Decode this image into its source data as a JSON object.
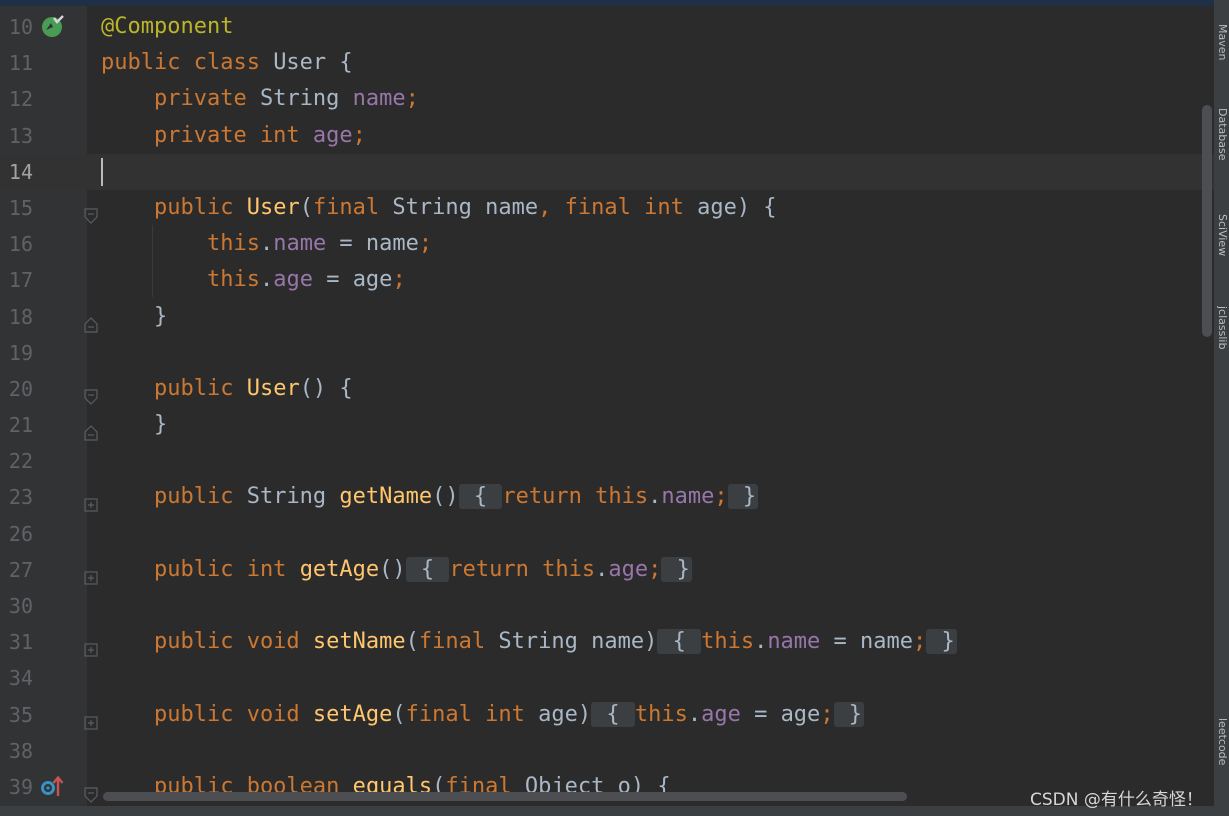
{
  "editor": {
    "lines": [
      {
        "no": "10",
        "tokens": [
          {
            "t": "@Component",
            "c": "a"
          }
        ]
      },
      {
        "no": "11",
        "tokens": [
          {
            "t": "public class ",
            "c": "k"
          },
          {
            "t": "User {",
            "c": "p"
          }
        ]
      },
      {
        "no": "12",
        "tokens": [
          {
            "t": "    private ",
            "c": "k"
          },
          {
            "t": "String ",
            "c": "p"
          },
          {
            "t": "name",
            "c": "f"
          },
          {
            "t": ";",
            "c": "k"
          }
        ]
      },
      {
        "no": "13",
        "tokens": [
          {
            "t": "    private int ",
            "c": "k"
          },
          {
            "t": "age",
            "c": "f"
          },
          {
            "t": ";",
            "c": "k"
          }
        ]
      },
      {
        "no": "14",
        "tokens": []
      },
      {
        "no": "15",
        "tokens": [
          {
            "t": "    public ",
            "c": "k"
          },
          {
            "t": "User",
            "c": "m"
          },
          {
            "t": "(",
            "c": "p"
          },
          {
            "t": "final ",
            "c": "k"
          },
          {
            "t": "String name",
            "c": "p"
          },
          {
            "t": ", ",
            "c": "k"
          },
          {
            "t": "final int ",
            "c": "k"
          },
          {
            "t": "age) {",
            "c": "p"
          }
        ]
      },
      {
        "no": "16",
        "tokens": [
          {
            "t": "        this",
            "c": "k"
          },
          {
            "t": ".",
            "c": "p"
          },
          {
            "t": "name",
            "c": "f"
          },
          {
            "t": " = name",
            "c": "p"
          },
          {
            "t": ";",
            "c": "k"
          }
        ]
      },
      {
        "no": "17",
        "tokens": [
          {
            "t": "        this",
            "c": "k"
          },
          {
            "t": ".",
            "c": "p"
          },
          {
            "t": "age",
            "c": "f"
          },
          {
            "t": " = age",
            "c": "p"
          },
          {
            "t": ";",
            "c": "k"
          }
        ]
      },
      {
        "no": "18",
        "tokens": [
          {
            "t": "    }",
            "c": "p"
          }
        ]
      },
      {
        "no": "19",
        "tokens": []
      },
      {
        "no": "20",
        "tokens": [
          {
            "t": "    public ",
            "c": "k"
          },
          {
            "t": "User",
            "c": "m"
          },
          {
            "t": "() {",
            "c": "p"
          }
        ]
      },
      {
        "no": "21",
        "tokens": [
          {
            "t": "    }",
            "c": "p"
          }
        ]
      },
      {
        "no": "22",
        "tokens": []
      },
      {
        "no": "23",
        "tokens": [
          {
            "t": "    public ",
            "c": "k"
          },
          {
            "t": "String ",
            "c": "p"
          },
          {
            "t": "getName",
            "c": "m"
          },
          {
            "t": "()",
            "c": "p"
          },
          {
            "t": " { ",
            "c": "p",
            "fold": true
          },
          {
            "t": "return this",
            "c": "k"
          },
          {
            "t": ".",
            "c": "p"
          },
          {
            "t": "name",
            "c": "f"
          },
          {
            "t": ";",
            "c": "k"
          },
          {
            "t": " }",
            "c": "p",
            "fold": true
          }
        ]
      },
      {
        "no": "26",
        "tokens": []
      },
      {
        "no": "27",
        "tokens": [
          {
            "t": "    public int ",
            "c": "k"
          },
          {
            "t": "getAge",
            "c": "m"
          },
          {
            "t": "()",
            "c": "p"
          },
          {
            "t": " { ",
            "c": "p",
            "fold": true
          },
          {
            "t": "return this",
            "c": "k"
          },
          {
            "t": ".",
            "c": "p"
          },
          {
            "t": "age",
            "c": "f"
          },
          {
            "t": ";",
            "c": "k"
          },
          {
            "t": " }",
            "c": "p",
            "fold": true
          }
        ]
      },
      {
        "no": "30",
        "tokens": []
      },
      {
        "no": "31",
        "tokens": [
          {
            "t": "    public void ",
            "c": "k"
          },
          {
            "t": "setName",
            "c": "m"
          },
          {
            "t": "(",
            "c": "p"
          },
          {
            "t": "final ",
            "c": "k"
          },
          {
            "t": "String name)",
            "c": "p"
          },
          {
            "t": " { ",
            "c": "p",
            "fold": true
          },
          {
            "t": "this",
            "c": "k"
          },
          {
            "t": ".",
            "c": "p"
          },
          {
            "t": "name",
            "c": "f"
          },
          {
            "t": " = name",
            "c": "p"
          },
          {
            "t": ";",
            "c": "k"
          },
          {
            "t": " }",
            "c": "p",
            "fold": true
          }
        ]
      },
      {
        "no": "34",
        "tokens": []
      },
      {
        "no": "35",
        "tokens": [
          {
            "t": "    public void ",
            "c": "k"
          },
          {
            "t": "setAge",
            "c": "m"
          },
          {
            "t": "(",
            "c": "p"
          },
          {
            "t": "final int ",
            "c": "k"
          },
          {
            "t": "age)",
            "c": "p"
          },
          {
            "t": " { ",
            "c": "p",
            "fold": true
          },
          {
            "t": "this",
            "c": "k"
          },
          {
            "t": ".",
            "c": "p"
          },
          {
            "t": "age",
            "c": "f"
          },
          {
            "t": " = age",
            "c": "p"
          },
          {
            "t": ";",
            "c": "k"
          },
          {
            "t": " }",
            "c": "p",
            "fold": true
          }
        ]
      },
      {
        "no": "38",
        "tokens": []
      },
      {
        "no": "39",
        "tokens": [
          {
            "t": "    public boolean ",
            "c": "k"
          },
          {
            "t": "equals",
            "c": "m"
          },
          {
            "t": "(",
            "c": "p"
          },
          {
            "t": "final ",
            "c": "k"
          },
          {
            "t": "Object o) {",
            "c": "p"
          }
        ]
      }
    ],
    "current_line": "14"
  },
  "gutter_icons": {
    "10": "bean-icon",
    "39": "override-method-icon"
  },
  "fold_markers": {
    "15": "fold-start-icon",
    "18": "fold-end-icon",
    "20": "fold-start-icon",
    "21": "fold-end-icon",
    "23": "fold-collapsed-icon",
    "27": "fold-collapsed-icon",
    "31": "fold-collapsed-icon",
    "35": "fold-collapsed-icon",
    "39": "fold-start-icon"
  },
  "right_tool_tabs": [
    "Maven",
    "Database",
    "SciView",
    "jclasslib",
    "leetcode"
  ],
  "watermark": "CSDN @有什么奇怪！",
  "colors": {
    "background": "#2b2b2b",
    "gutter": "#313335",
    "keyword": "#cc7832",
    "field": "#9876aa",
    "method": "#ffc66d",
    "annotation": "#bbb529",
    "plain": "#a9b7c6",
    "line_number": "#606366"
  }
}
